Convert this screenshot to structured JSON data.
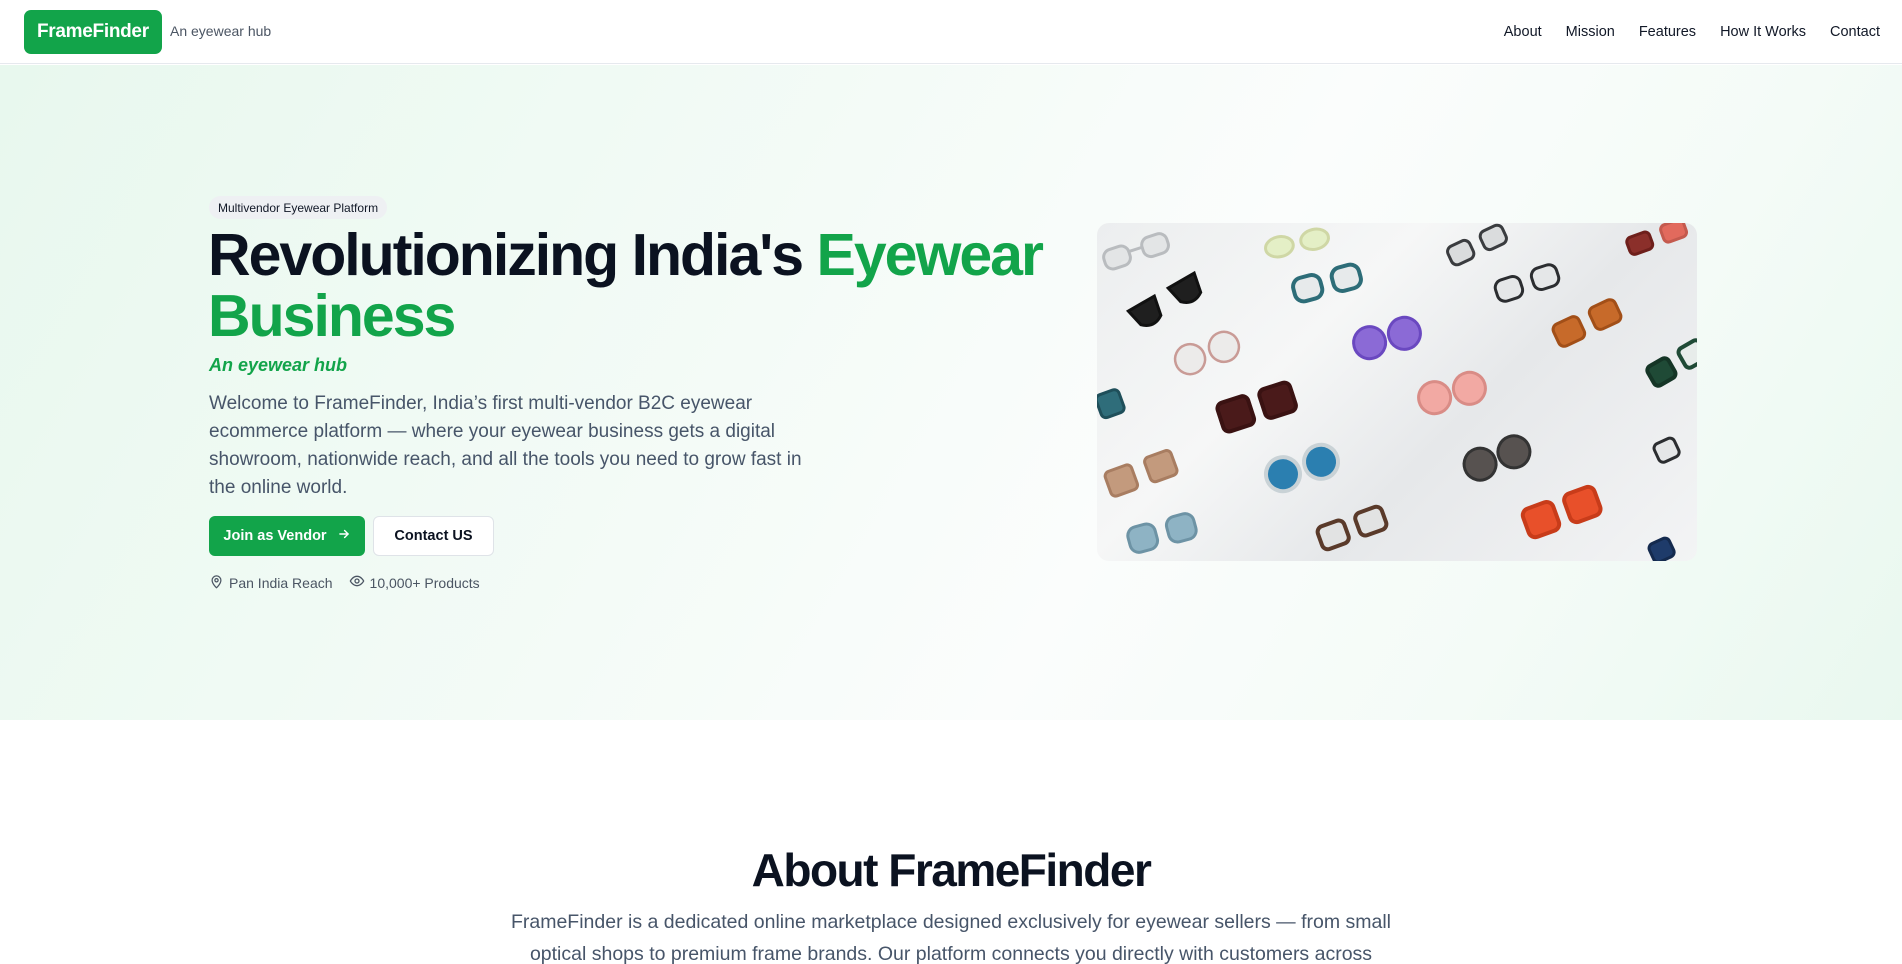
{
  "header": {
    "logo": "FrameFinder",
    "tagline": "An eyewear hub",
    "nav": [
      "About",
      "Mission",
      "Features",
      "How It Works",
      "Contact"
    ]
  },
  "hero": {
    "badge": "Multivendor Eyewear Platform",
    "headline_main": "Revolutionizing India's ",
    "headline_accent": "Eyewear Business",
    "subtitle": "An eyewear hub",
    "description": "Welcome to FrameFinder, India’s first multi-vendor B2C eyewear ecommerce platform — where your eyewear business gets a digital showroom, nationwide reach, and all the tools you need to grow fast in the online world.",
    "primary_button": "Join as Vendor",
    "secondary_button": "Contact US",
    "stats": [
      {
        "icon": "map-pin-icon",
        "label": "Pan India Reach"
      },
      {
        "icon": "eye-icon",
        "label": "10,000+ Products"
      }
    ]
  },
  "about": {
    "title": "About FrameFinder",
    "description": "FrameFinder is a dedicated online marketplace designed exclusively for eyewear sellers — from small optical shops to premium frame brands. Our platform connects you directly with customers across"
  },
  "colors": {
    "brand": "#12a44a",
    "heading": "#0b1220",
    "body_text": "#475569"
  }
}
